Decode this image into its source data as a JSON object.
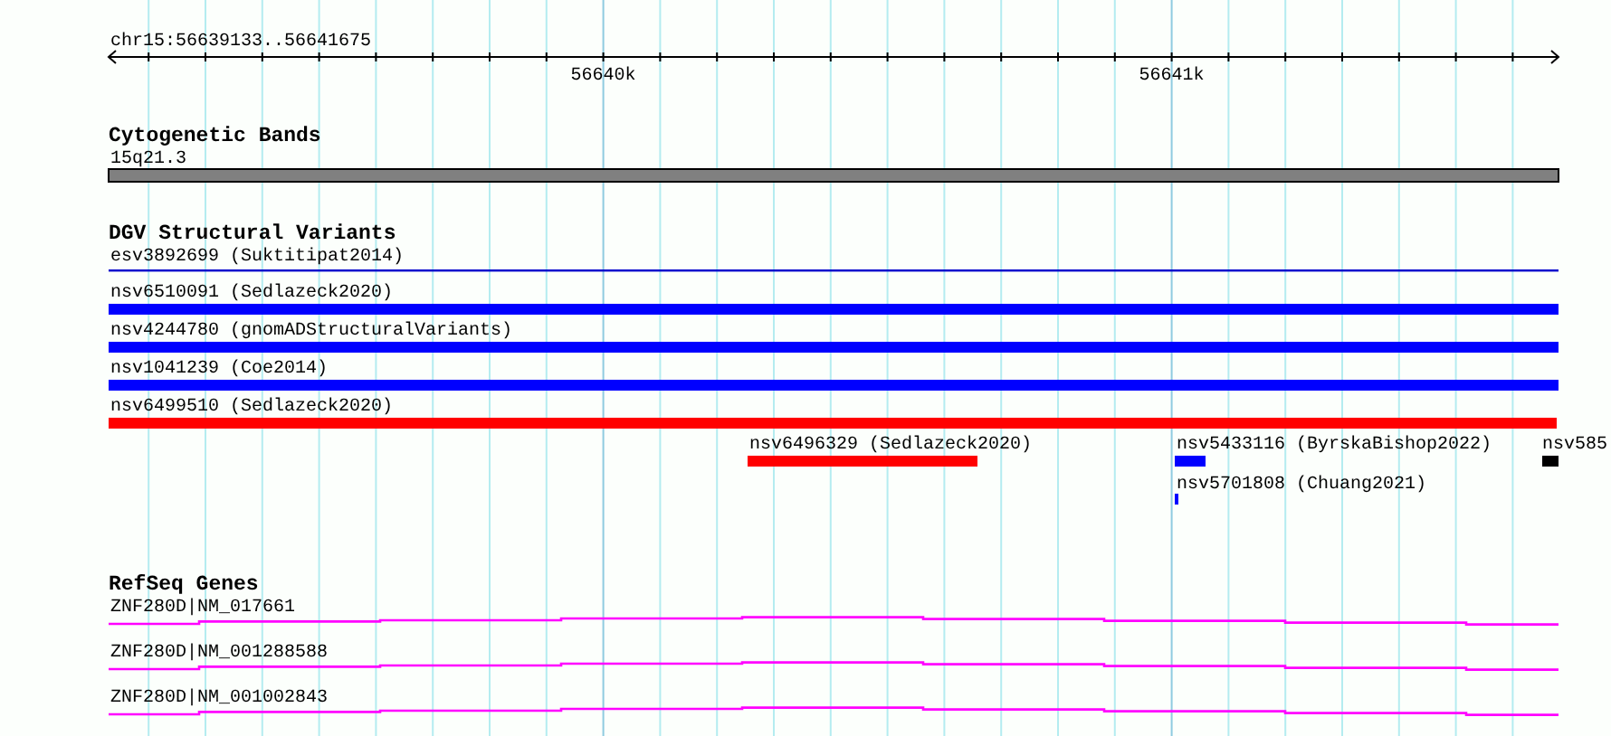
{
  "ruler": {
    "region": "chr15:56639133..56641675",
    "ticks": [
      "56640k",
      "56641k"
    ]
  },
  "tracks": [
    {
      "title": "Cytogenetic Bands",
      "kind": "bands",
      "features": [
        {
          "label": "15q21.3"
        }
      ]
    },
    {
      "title": "DGV Structural Variants",
      "kind": "variants",
      "features": [
        {
          "label": "esv3892699 (Suktitipat2014)",
          "kind": "line",
          "color": "#0000cc"
        },
        {
          "label": "nsv6510091 (Sedlazeck2020)",
          "kind": "bar",
          "color": "#0000ff"
        },
        {
          "label": "nsv4244780 (gnomADStructuralVariants)",
          "kind": "bar",
          "color": "#0000ff"
        },
        {
          "label": "nsv1041239 (Coe2014)",
          "kind": "bar",
          "color": "#0000ff"
        },
        {
          "label": "nsv6499510 (Sedlazeck2020)",
          "kind": "bar",
          "color": "#ff0000"
        },
        {
          "label": "nsv6496329 (Sedlazeck2020)",
          "kind": "bar",
          "color": "#ff0000"
        },
        {
          "label": "nsv5433116 (ByrskaBishop2022)",
          "kind": "bar",
          "color": "#0000ff"
        },
        {
          "label": "nsv5701808 (Chuang2021)",
          "kind": "bar",
          "color": "#0000ff"
        },
        {
          "label": "nsv585",
          "kind": "bar",
          "color": "#000000"
        }
      ]
    },
    {
      "title": "RefSeq Genes",
      "kind": "genes",
      "features": [
        {
          "label": "ZNF280D|NM_017661"
        },
        {
          "label": "ZNF280D|NM_001288588"
        },
        {
          "label": "ZNF280D|NM_001002843"
        }
      ]
    }
  ]
}
